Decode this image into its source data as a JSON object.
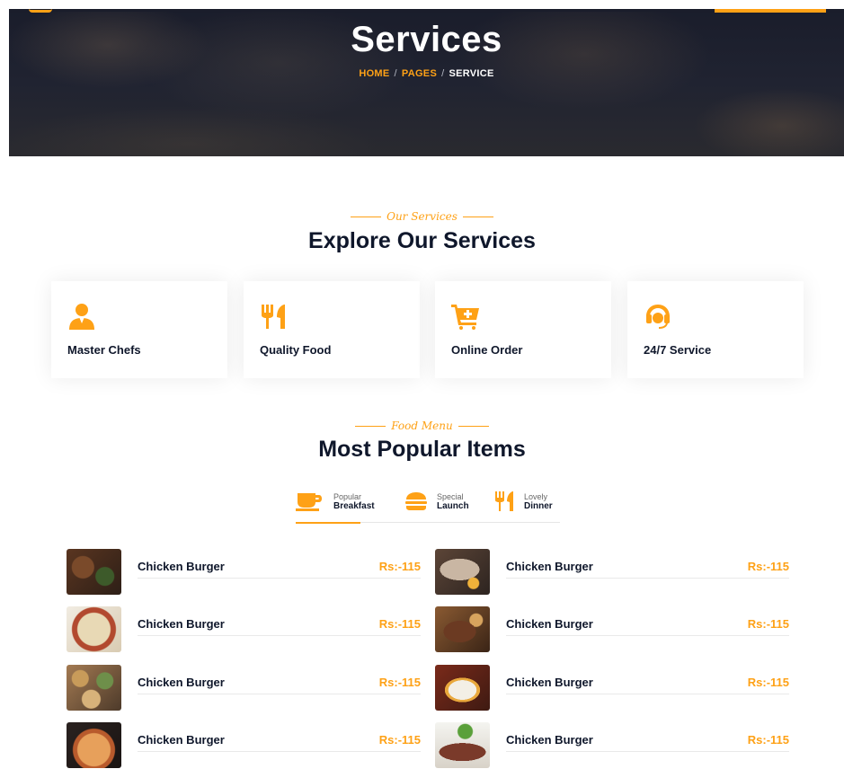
{
  "hero": {
    "title": "Services",
    "breadcrumb": [
      {
        "label": "HOME"
      },
      {
        "label": "PAGES"
      },
      {
        "label": "SERVICE"
      }
    ],
    "separator": "/"
  },
  "services_section": {
    "kicker": "Our Services",
    "title": "Explore Our Services",
    "cards": [
      {
        "label": "Master Chefs",
        "icon": "chef-icon"
      },
      {
        "label": "Quality Food",
        "icon": "utensils-icon"
      },
      {
        "label": "Online Order",
        "icon": "cart-plus-icon"
      },
      {
        "label": "24/7 Service",
        "icon": "headset-icon"
      }
    ]
  },
  "menu_section": {
    "kicker": "Food Menu",
    "title": "Most Popular Items",
    "tabs": [
      {
        "small": "Popular",
        "big": "Breakfast",
        "icon": "coffee-icon",
        "active": true
      },
      {
        "small": "Special",
        "big": "Launch",
        "icon": "hamburger-icon",
        "active": false
      },
      {
        "small": "Lovely",
        "big": "Dinner",
        "icon": "utensils-icon",
        "active": false
      }
    ],
    "items": [
      {
        "name": "Chicken Burger",
        "price": "Rs:-115"
      },
      {
        "name": "Chicken Burger",
        "price": "Rs:-115"
      },
      {
        "name": "Chicken Burger",
        "price": "Rs:-115"
      },
      {
        "name": "Chicken Burger",
        "price": "Rs:-115"
      },
      {
        "name": "Chicken Burger",
        "price": "Rs:-115"
      },
      {
        "name": "Chicken Burger",
        "price": "Rs:-115"
      },
      {
        "name": "Chicken Burger",
        "price": "Rs:-115"
      },
      {
        "name": "Chicken Burger",
        "price": "Rs:-115"
      }
    ]
  },
  "colors": {
    "accent": "#fea116",
    "heading": "#0f172b",
    "hero_bg": "#1a1d2b"
  }
}
